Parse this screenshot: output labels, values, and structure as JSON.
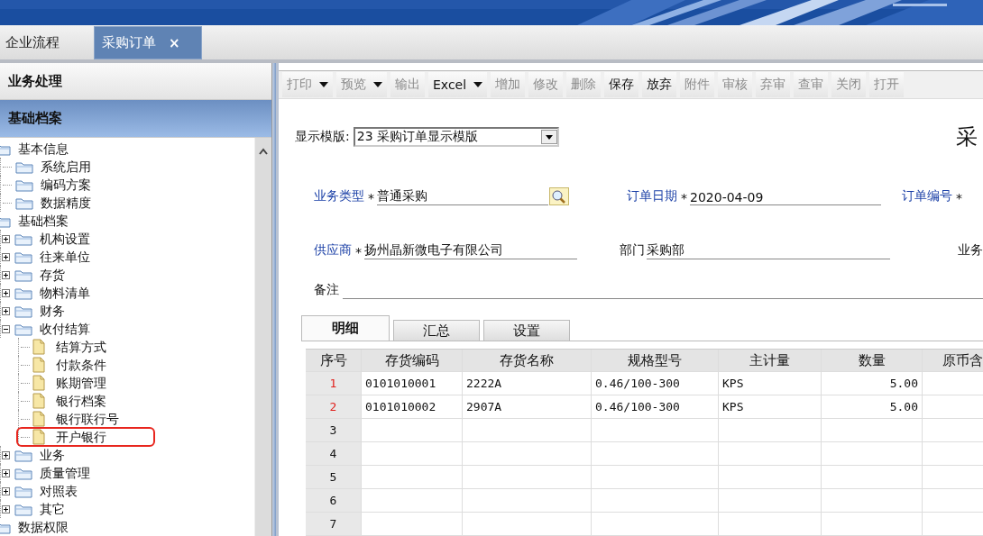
{
  "tabs": [
    {
      "label": "企业流程",
      "selected": false
    },
    {
      "label": "采购订单",
      "selected": true,
      "close": "×"
    }
  ],
  "sidebar": {
    "sections": [
      {
        "label": "业务处理",
        "selected": false
      },
      {
        "label": "基础档案",
        "selected": true
      }
    ],
    "tree": [
      {
        "label": "基本信息",
        "kind": "folder",
        "children": [
          {
            "label": "系统启用",
            "kind": "folder"
          },
          {
            "label": "编码方案",
            "kind": "folder"
          },
          {
            "label": "数据精度",
            "kind": "folder"
          }
        ]
      },
      {
        "label": "基础档案",
        "kind": "folder",
        "children": [
          {
            "label": "机构设置",
            "kind": "folder",
            "expanded": false
          },
          {
            "label": "往来单位",
            "kind": "folder",
            "expanded": false
          },
          {
            "label": "存货",
            "kind": "folder",
            "expanded": false
          },
          {
            "label": "物料清单",
            "kind": "folder",
            "expanded": false
          },
          {
            "label": "财务",
            "kind": "folder",
            "expanded": false
          },
          {
            "label": "收付结算",
            "kind": "folder",
            "expanded": true,
            "children": [
              {
                "label": "结算方式",
                "kind": "file",
                "highlighted": false
              },
              {
                "label": "付款条件",
                "kind": "file",
                "highlighted": false
              },
              {
                "label": "账期管理",
                "kind": "file",
                "highlighted": false
              },
              {
                "label": "银行档案",
                "kind": "file",
                "highlighted": false
              },
              {
                "label": "银行联行号",
                "kind": "file",
                "highlighted": false
              },
              {
                "label": "开户银行",
                "kind": "file",
                "highlighted": true
              }
            ]
          },
          {
            "label": "业务",
            "kind": "folder",
            "expanded": false
          },
          {
            "label": "质量管理",
            "kind": "folder",
            "expanded": false
          },
          {
            "label": "对照表",
            "kind": "folder",
            "expanded": false
          },
          {
            "label": "其它",
            "kind": "folder",
            "expanded": false
          }
        ]
      },
      {
        "label": "数据权限",
        "kind": "folder"
      }
    ]
  },
  "toolbar": [
    {
      "label": "打印",
      "disabled": true,
      "dropdown": true
    },
    {
      "label": "预览",
      "disabled": true,
      "dropdown": true
    },
    {
      "label": "输出",
      "disabled": true,
      "dropdown": false
    },
    {
      "label": "Excel",
      "disabled": false,
      "dropdown": true
    },
    {
      "label": "增加",
      "disabled": true,
      "dropdown": false
    },
    {
      "label": "修改",
      "disabled": true,
      "dropdown": false
    },
    {
      "label": "删除",
      "disabled": true,
      "dropdown": false
    },
    {
      "label": "保存",
      "disabled": false,
      "dropdown": false
    },
    {
      "label": "放弃",
      "disabled": false,
      "dropdown": false
    },
    {
      "label": "附件",
      "disabled": true,
      "dropdown": false
    },
    {
      "label": "审核",
      "disabled": true,
      "dropdown": false
    },
    {
      "label": "弃审",
      "disabled": true,
      "dropdown": false
    },
    {
      "label": "查审",
      "disabled": true,
      "dropdown": false
    },
    {
      "label": "关闭",
      "disabled": true,
      "dropdown": false
    },
    {
      "label": "打开",
      "disabled": true,
      "dropdown": false
    }
  ],
  "template": {
    "label": "显示模版:",
    "value": "23 采购订单显示模版"
  },
  "title": "采",
  "form": {
    "rows": [
      [
        {
          "label": "业务类型",
          "required": true,
          "marker": "*",
          "value": "普通采购",
          "lookup": true
        },
        {
          "label": "订单日期",
          "required": true,
          "marker": "*",
          "value": "2020-04-09"
        },
        {
          "label": "订单编号",
          "required": true,
          "marker": "*"
        }
      ],
      [
        {
          "label": "供应商",
          "required": true,
          "marker": "*",
          "value": "扬州晶新微电子有限公司"
        },
        {
          "label": "部门",
          "required": false,
          "value": "采购部"
        },
        {
          "label": "业务",
          "required": false
        }
      ]
    ],
    "note": {
      "label": "备注"
    }
  },
  "detail_tabs": [
    {
      "label": "明细",
      "selected": true
    },
    {
      "label": "汇总",
      "selected": false
    },
    {
      "label": "设置",
      "selected": false
    }
  ],
  "table": {
    "columns": [
      "序号",
      "存货编码",
      "存货名称",
      "规格型号",
      "主计量",
      "数量",
      "原币含"
    ],
    "rows": [
      {
        "modified": true,
        "cells": [
          "1",
          "0101010001",
          "2222A",
          "0.46/100-300",
          "KPS",
          "5.00"
        ]
      },
      {
        "modified": true,
        "cells": [
          "2",
          "0101010002",
          "2907A",
          "0.46/100-300",
          "KPS",
          "5.00"
        ]
      },
      {
        "modified": false,
        "cells": [
          "3"
        ]
      },
      {
        "modified": false,
        "cells": [
          "4"
        ]
      },
      {
        "modified": false,
        "cells": [
          "5"
        ]
      },
      {
        "modified": false,
        "cells": [
          "6"
        ]
      },
      {
        "modified": false,
        "cells": [
          "7"
        ]
      }
    ]
  }
}
